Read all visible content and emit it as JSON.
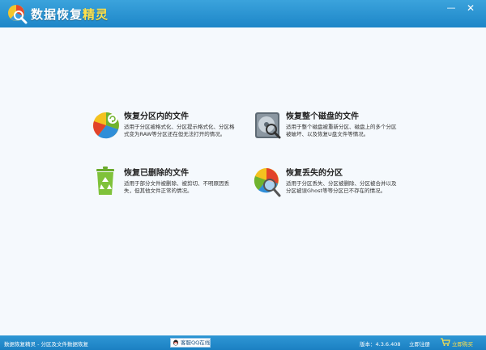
{
  "window": {
    "title_main": "数据恢复",
    "title_accent": "精灵",
    "minimize_glyph": "—",
    "close_glyph": "✕"
  },
  "options": [
    {
      "title": "恢复分区内的文件",
      "description": "适用于分区被格式化、分区提示格式化、分区格式变为RAW等分区还在但无法打开的情况。",
      "icon": "pie-chart-refresh-icon"
    },
    {
      "title": "恢复整个磁盘的文件",
      "description": "适用于整个磁盘被重新分区、磁盘上的多个分区被破坏、以及恢复U盘文件等情况。",
      "icon": "hard-disk-search-icon"
    },
    {
      "title": "恢复已删除的文件",
      "description": "适用于部分文件被删除、被剪切、不明原因丢失，但其他文件正常的情况。",
      "icon": "recycle-bin-icon"
    },
    {
      "title": "恢复丢失的分区",
      "description": "适用于分区丢失、分区被删除、分区被合并以及分区被误Ghost等等分区已不存在的情况。",
      "icon": "pie-chart-search-icon"
    }
  ],
  "statusbar": {
    "left_text": "数据恢复精灵 - 分区及文件数据恢复",
    "qq_button": "客服QQ在线",
    "version": "版本：4.3.6.408",
    "register": "立即注册",
    "buy": "立即购买"
  },
  "colors": {
    "titlebar": "#2994d2",
    "accent_yellow": "#ffe14a",
    "background": "#f5f9fd"
  }
}
